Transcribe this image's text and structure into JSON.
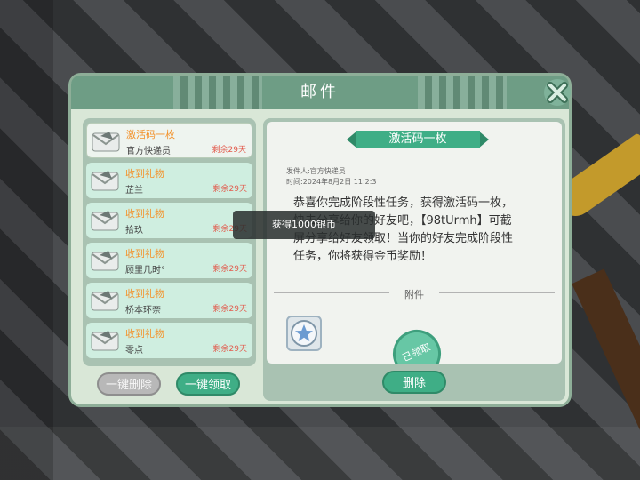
{
  "dialog": {
    "title": "邮件",
    "close_icon": "close-x-icon"
  },
  "mail_list": [
    {
      "subject": "激活码一枚",
      "sender": "官方快递员",
      "remaining": "剩余29天",
      "selected": true
    },
    {
      "subject": "收到礼物",
      "sender": "芷兰",
      "remaining": "剩余29天",
      "selected": false
    },
    {
      "subject": "收到礼物",
      "sender": "拾玖",
      "remaining": "剩余29天",
      "selected": false
    },
    {
      "subject": "收到礼物",
      "sender": "顾里几时°",
      "remaining": "剩余29天",
      "selected": false
    },
    {
      "subject": "收到礼物",
      "sender": "桥本环奈",
      "remaining": "剩余29天",
      "selected": false
    },
    {
      "subject": "收到礼物",
      "sender": "零点",
      "remaining": "剩余29天",
      "selected": false
    }
  ],
  "buttons": {
    "delete_all": "一键删除",
    "claim_all": "一键领取",
    "delete": "删除"
  },
  "detail": {
    "subject": "激活码一枚",
    "sender_line": "发件人:官方快递员",
    "time_line": "时间:2024年8月2日 11:2:3",
    "body_line_1": "恭喜你完成阶段性任务，获得激活码一枚，",
    "body_line_2": "快去分享给你的好友吧，【98tUrmh】可截",
    "body_line_3": "屏分享给好友领取！当你的好友完成阶段性",
    "body_line_4": "任务，你将获得金币奖励！",
    "attachment_label": "附件",
    "claimed_stamp": "已领取",
    "attachment_icon": "star-badge-icon"
  },
  "toast": {
    "text": "获得1000银币"
  },
  "colors": {
    "title_bar": "#6e9d85",
    "panel": "#a9c2b2",
    "accent_green": "#3fae86",
    "subject_orange": "#f3922b",
    "remaining_red": "#e25a4c"
  }
}
